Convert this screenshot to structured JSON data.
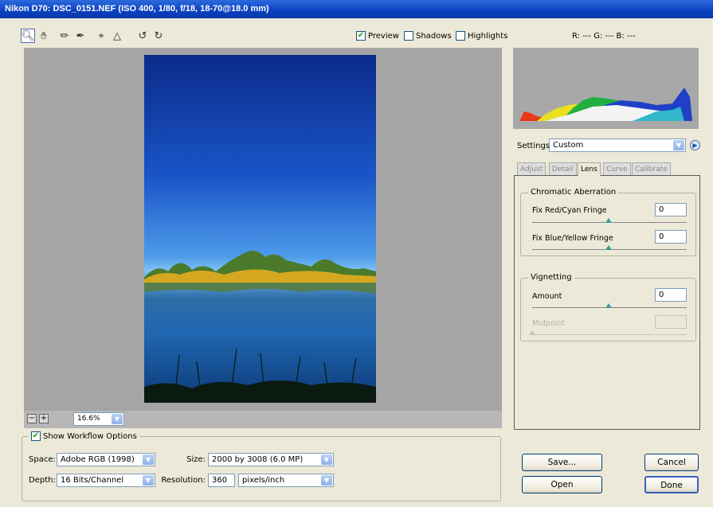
{
  "window": {
    "title": "Nikon D70:  DSC_0151.NEF  (ISO 400, 1/80, f/18, 18-70@18.0 mm)"
  },
  "toolbar": {
    "tools": [
      "zoom-tool",
      "hand-tool",
      "white-balance-tool",
      "color-sampler-tool",
      "crop-tool",
      "straighten-tool",
      "rotate-left",
      "rotate-right"
    ],
    "preview_label": "Preview",
    "preview_checked": true,
    "shadows_label": "Shadows",
    "shadows_checked": false,
    "highlights_label": "Highlights",
    "highlights_checked": false,
    "rgb_readout": "R: ---   G: ---   B: ---"
  },
  "zoom": {
    "value": "16.6%",
    "minus": "−",
    "plus": "+"
  },
  "workflow": {
    "label": "Show Workflow Options",
    "checked": true,
    "space_label": "Space:",
    "space_value": "Adobe RGB (1998)",
    "depth_label": "Depth:",
    "depth_value": "16 Bits/Channel",
    "size_label": "Size:",
    "size_value": "2000 by 3008 (6.0 MP)",
    "resolution_label": "Resolution:",
    "resolution_value": "360",
    "resolution_unit": "pixels/inch"
  },
  "settings": {
    "label": "Settings:",
    "value": "Custom"
  },
  "tabs": [
    {
      "label": "Adjust"
    },
    {
      "label": "Detail"
    },
    {
      "label": "Lens"
    },
    {
      "label": "Curve"
    },
    {
      "label": "Calibrate"
    }
  ],
  "active_tab": "Lens",
  "lens": {
    "chromatic_title": "Chromatic Aberration",
    "red_cyan_label": "Fix Red/Cyan Fringe",
    "red_cyan_value": "0",
    "blue_yellow_label": "Fix Blue/Yellow Fringe",
    "blue_yellow_value": "0",
    "vignetting_title": "Vignetting",
    "amount_label": "Amount",
    "amount_value": "0",
    "midpoint_label": "Midpoint",
    "midpoint_value": ""
  },
  "buttons": {
    "save": "Save...",
    "cancel": "Cancel",
    "open": "Open",
    "done": "Done"
  },
  "colors": {
    "title_bar": "#0a40c0",
    "preview_bg": "#a5a5a5",
    "dialog_bg": "#ece9d8"
  }
}
